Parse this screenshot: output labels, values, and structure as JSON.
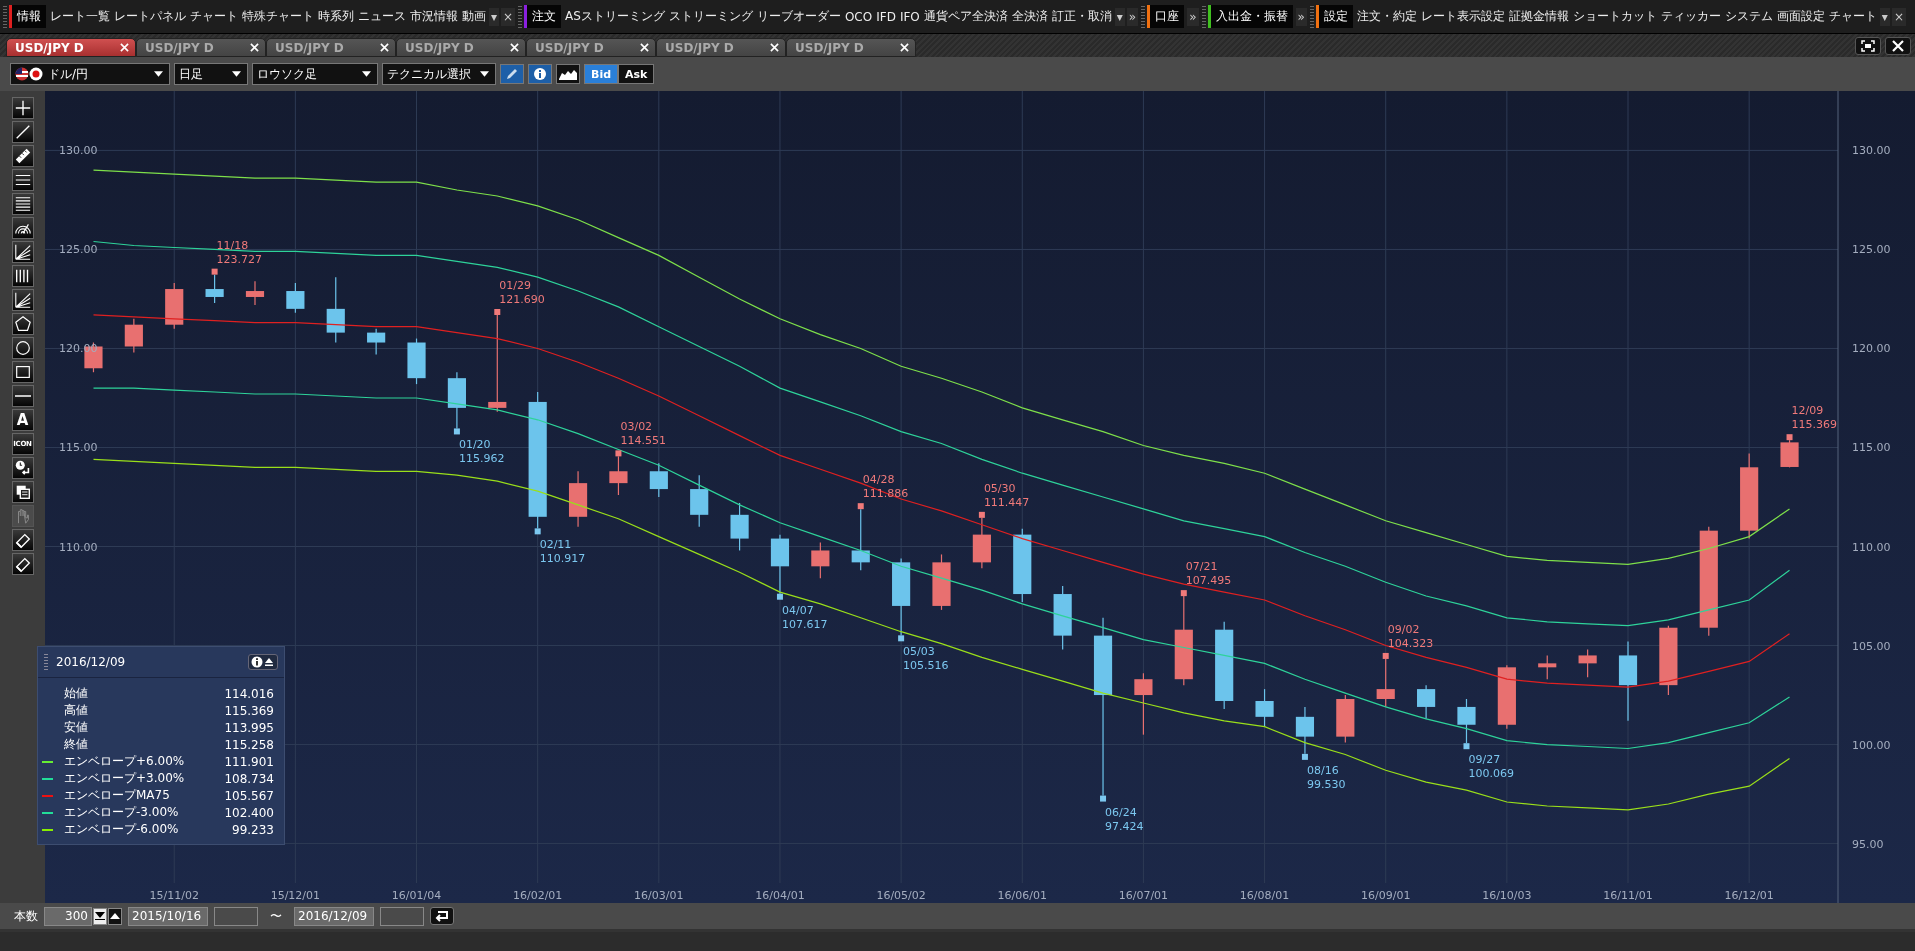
{
  "menu_groups": [
    {
      "title": "情報",
      "color": "#e02020",
      "items": [
        "レート一覧",
        "レートパネル",
        "チャート",
        "特殊チャート",
        "時系列",
        "ニュース",
        "市況情報",
        "動画"
      ],
      "tail": [
        "▾",
        "×"
      ]
    },
    {
      "title": "注文",
      "color": "#8a20e0",
      "items": [
        "ASストリーミング",
        "ストリーミング",
        "リーブオーダー",
        "OCO",
        "IFD",
        "IFO",
        "通貨ペア全決済",
        "全決済",
        "訂正・取消"
      ],
      "tail": [
        "▾",
        "»"
      ]
    },
    {
      "title": "口座",
      "color": "#f07010",
      "tail": [
        "»"
      ]
    },
    {
      "title": "入出金・振替",
      "color": "#40c020",
      "tail": [
        "»"
      ]
    },
    {
      "title": "設定",
      "color": "#f07010",
      "items": [
        "注文・約定",
        "レート表示設定",
        "証拠金情報",
        "ショートカット",
        "ティッカー",
        "システム",
        "画面設定",
        "チャート"
      ],
      "tail": [
        "▾",
        "×"
      ]
    }
  ],
  "tabs": [
    {
      "label": "USD/JPY D",
      "selected": true
    },
    {
      "label": "USD/JPY D",
      "selected": false
    },
    {
      "label": "USD/JPY D",
      "selected": false
    },
    {
      "label": "USD/JPY D",
      "selected": false
    },
    {
      "label": "USD/JPY D",
      "selected": false
    },
    {
      "label": "USD/JPY D",
      "selected": false
    },
    {
      "label": "USD/JPY D",
      "selected": false
    }
  ],
  "toolbar": {
    "pair": "ドル/円",
    "period": "日足",
    "style": "ロウソク足",
    "technical": "テクニカル選択",
    "price_modes": [
      {
        "label": "Bid",
        "selected": true
      },
      {
        "label": "Ask",
        "selected": false
      }
    ]
  },
  "tools": [
    {
      "kind": "crosshair",
      "disabled": false
    },
    {
      "kind": "trendline",
      "disabled": false
    },
    {
      "kind": "ruler",
      "disabled": false
    },
    {
      "kind": "lines3",
      "disabled": false
    },
    {
      "kind": "lines5",
      "disabled": false
    },
    {
      "kind": "arcs",
      "disabled": false
    },
    {
      "kind": "fan",
      "disabled": false
    },
    {
      "kind": "vlines",
      "disabled": false
    },
    {
      "kind": "fan",
      "disabled": false
    },
    {
      "kind": "pentagon",
      "disabled": false
    },
    {
      "kind": "circle",
      "disabled": false
    },
    {
      "kind": "rect",
      "disabled": false
    },
    {
      "kind": "hline",
      "disabled": false
    },
    {
      "kind": "text",
      "label": "A",
      "disabled": false
    },
    {
      "kind": "stamp",
      "label": "ICON",
      "disabled": false
    },
    {
      "kind": "clock",
      "disabled": false
    },
    {
      "kind": "copy",
      "disabled": false
    },
    {
      "kind": "hand",
      "disabled": true
    },
    {
      "kind": "eraser",
      "disabled": false
    },
    {
      "kind": "eraser",
      "disabled": false
    }
  ],
  "chart": {
    "chart_data": {
      "type": "candlestick",
      "categories": [
        null,
        null,
        "15/11/02",
        null,
        null,
        "15/12/01",
        null,
        null,
        "16/01/04",
        null,
        null,
        "16/02/01",
        null,
        null,
        "16/03/01",
        null,
        null,
        "16/04/01",
        null,
        null,
        "16/05/02",
        null,
        null,
        "16/06/01",
        null,
        null,
        "16/07/01",
        null,
        null,
        "16/08/01",
        null,
        null,
        "16/09/01",
        null,
        null,
        "16/10/03",
        null,
        null,
        "16/11/01",
        null,
        null,
        "16/12/01",
        null
      ],
      "ohlc": [
        [
          119.0,
          120.3,
          118.8,
          120.1
        ],
        [
          120.1,
          121.5,
          119.8,
          121.2
        ],
        [
          121.2,
          123.3,
          121.0,
          123.0
        ],
        [
          123.0,
          123.727,
          122.3,
          122.6
        ],
        [
          122.6,
          123.4,
          122.2,
          122.9
        ],
        [
          122.9,
          123.3,
          121.8,
          122.0
        ],
        [
          122.0,
          123.6,
          120.3,
          120.8
        ],
        [
          120.8,
          121.0,
          119.7,
          120.3
        ],
        [
          120.3,
          120.5,
          118.2,
          118.5
        ],
        [
          118.5,
          118.8,
          115.962,
          117.0
        ],
        [
          117.0,
          121.69,
          116.8,
          117.3
        ],
        [
          117.3,
          117.8,
          110.917,
          111.5
        ],
        [
          111.5,
          113.8,
          111.0,
          113.2
        ],
        [
          113.2,
          114.551,
          112.6,
          113.8
        ],
        [
          113.8,
          114.2,
          112.5,
          112.9
        ],
        [
          112.9,
          113.6,
          111.0,
          111.6
        ],
        [
          111.6,
          112.2,
          109.8,
          110.4
        ],
        [
          110.4,
          110.6,
          107.617,
          109.0
        ],
        [
          109.0,
          110.2,
          108.4,
          109.8
        ],
        [
          109.8,
          111.886,
          108.8,
          109.2
        ],
        [
          109.2,
          109.4,
          105.516,
          107.0
        ],
        [
          107.0,
          109.6,
          106.8,
          109.2
        ],
        [
          109.2,
          111.447,
          108.9,
          110.6
        ],
        [
          110.6,
          110.9,
          107.2,
          107.6
        ],
        [
          107.6,
          108.0,
          104.8,
          105.5
        ],
        [
          105.5,
          106.4,
          97.424,
          102.5
        ],
        [
          102.5,
          103.6,
          100.5,
          103.3
        ],
        [
          103.3,
          107.495,
          103.0,
          105.8
        ],
        [
          105.8,
          106.2,
          101.8,
          102.2
        ],
        [
          102.2,
          102.8,
          100.9,
          101.4
        ],
        [
          101.4,
          101.9,
          99.53,
          100.4
        ],
        [
          100.4,
          102.5,
          100.1,
          102.3
        ],
        [
          102.3,
          104.323,
          101.9,
          102.8
        ],
        [
          102.8,
          103.0,
          101.3,
          101.9
        ],
        [
          101.9,
          102.3,
          100.069,
          101.0
        ],
        [
          101.0,
          104.0,
          100.8,
          103.9
        ],
        [
          103.9,
          104.5,
          103.3,
          104.1
        ],
        [
          104.1,
          104.8,
          103.4,
          104.5
        ],
        [
          104.5,
          105.2,
          101.2,
          103.0
        ],
        [
          103.0,
          106.0,
          102.5,
          105.9
        ],
        [
          105.9,
          111.0,
          105.5,
          110.8
        ],
        [
          110.8,
          114.7,
          110.4,
          114.0
        ],
        [
          114.016,
          115.369,
          113.995,
          115.258
        ]
      ],
      "series": [
        {
          "type": "line",
          "color": "#7ee04a",
          "values": [
            129.0,
            128.9,
            128.8,
            128.7,
            128.6,
            128.6,
            128.5,
            128.4,
            128.4,
            128.0,
            127.7,
            127.2,
            126.5,
            125.6,
            124.7,
            123.6,
            122.5,
            121.5,
            120.7,
            120.0,
            119.1,
            118.5,
            117.8,
            117.0,
            116.4,
            115.8,
            115.1,
            114.6,
            114.2,
            113.7,
            112.9,
            112.1,
            111.3,
            110.7,
            110.1,
            109.5,
            109.3,
            109.2,
            109.1,
            109.4,
            109.9,
            110.5,
            111.9
          ]
        },
        {
          "type": "line",
          "color": "#2ed39a",
          "values": [
            125.4,
            125.2,
            125.1,
            125.0,
            124.9,
            124.9,
            124.8,
            124.7,
            124.7,
            124.4,
            124.1,
            123.6,
            122.9,
            122.1,
            121.1,
            120.1,
            119.1,
            118.0,
            117.3,
            116.6,
            115.8,
            115.2,
            114.4,
            113.7,
            113.1,
            112.5,
            111.9,
            111.3,
            110.9,
            110.5,
            109.7,
            109.0,
            108.2,
            107.5,
            107.0,
            106.4,
            106.2,
            106.1,
            106.0,
            106.3,
            106.8,
            107.3,
            108.8
          ]
        },
        {
          "type": "line",
          "color": "#e02020",
          "values": [
            121.7,
            121.6,
            121.5,
            121.4,
            121.3,
            121.3,
            121.2,
            121.1,
            121.1,
            120.8,
            120.5,
            120.0,
            119.3,
            118.5,
            117.6,
            116.6,
            115.6,
            114.6,
            113.9,
            113.2,
            112.4,
            111.8,
            111.1,
            110.4,
            109.8,
            109.2,
            108.6,
            108.1,
            107.7,
            107.3,
            106.5,
            105.8,
            105.0,
            104.4,
            103.9,
            103.3,
            103.1,
            103.0,
            102.9,
            103.2,
            103.7,
            104.2,
            105.6
          ]
        },
        {
          "type": "line",
          "color": "#2ed39a",
          "values": [
            118.0,
            118.0,
            117.9,
            117.8,
            117.7,
            117.7,
            117.6,
            117.5,
            117.5,
            117.2,
            116.9,
            116.4,
            115.7,
            114.9,
            114.1,
            113.1,
            112.1,
            111.2,
            110.5,
            109.8,
            109.0,
            108.4,
            107.8,
            107.1,
            106.5,
            105.9,
            105.3,
            104.9,
            104.5,
            104.1,
            103.3,
            102.6,
            101.9,
            101.3,
            100.8,
            100.2,
            100.0,
            99.9,
            99.8,
            100.1,
            100.6,
            101.1,
            102.4
          ]
        },
        {
          "type": "line",
          "color": "#9adf1a",
          "values": [
            114.4,
            114.3,
            114.2,
            114.1,
            114.0,
            114.0,
            113.9,
            113.8,
            113.8,
            113.6,
            113.3,
            112.8,
            112.1,
            111.4,
            110.5,
            109.6,
            108.7,
            107.7,
            107.1,
            106.4,
            105.7,
            105.1,
            104.4,
            103.8,
            103.2,
            102.6,
            102.1,
            101.6,
            101.2,
            100.9,
            100.1,
            99.5,
            98.7,
            98.1,
            97.7,
            97.1,
            96.9,
            96.8,
            96.7,
            97.0,
            97.5,
            97.9,
            99.3
          ]
        }
      ],
      "grid": true,
      "ylim": [
        92,
        133
      ],
      "yticks": [
        {
          "value": 130,
          "label": "130.00"
        },
        {
          "value": 125,
          "label": "125.00"
        },
        {
          "value": 120,
          "label": "120.00"
        },
        {
          "value": 115,
          "label": "115.00"
        },
        {
          "value": 110,
          "label": "110.00"
        },
        {
          "value": 105,
          "label": "105.00"
        },
        {
          "value": 100,
          "label": "100.00"
        },
        {
          "value": 95,
          "label": "95.00"
        }
      ],
      "annotations": [
        "11/18\n123.727",
        "01/20\n115.962",
        "01/29\n121.690",
        "02/11\n110.917",
        "03/02\n114.551",
        "04/07\n107.617",
        "04/28\n111.886",
        "05/03\n105.516",
        "05/30\n111.447",
        "06/24\n97.424",
        "07/21\n107.495",
        "08/16\n99.530",
        "09/02\n104.323",
        "09/27\n100.069",
        "12/09\n115.369"
      ]
    }
  },
  "info_panel": {
    "date": "2016/12/09",
    "rows": [
      {
        "label": "始値",
        "value": "114.016"
      },
      {
        "label": "高値",
        "value": "115.369"
      },
      {
        "label": "安値",
        "value": "113.995"
      },
      {
        "label": "終値",
        "value": "115.258"
      },
      {
        "label": "エンベロープ+6.00%",
        "value": "111.901",
        "color": "#66ee33"
      },
      {
        "label": "エンベロープ+3.00%",
        "value": "108.734",
        "color": "#22dd99"
      },
      {
        "label": "エンベロープMA75",
        "value": "105.567",
        "color": "#ee1111"
      },
      {
        "label": "エンベロープ-3.00%",
        "value": "102.400",
        "color": "#22dd99"
      },
      {
        "label": "エンベロープ-6.00%",
        "value": "99.233",
        "color": "#88ee00"
      }
    ]
  },
  "bottom_bar": {
    "count_label": "本数",
    "count": "300",
    "from": "2015/10/16",
    "separator": "〜",
    "to": "2016/12/09"
  }
}
